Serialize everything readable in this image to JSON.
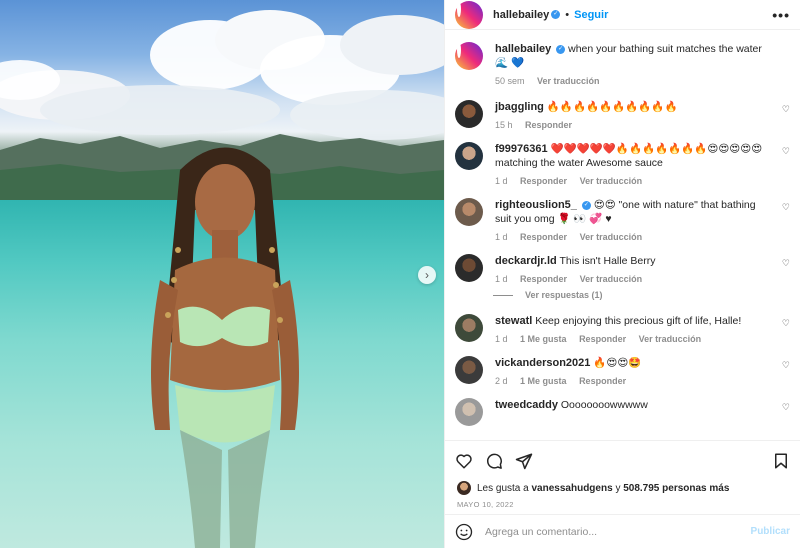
{
  "post": {
    "account": "hallebailey",
    "follow_label": "Seguir",
    "more_label": "•••",
    "separator": "•"
  },
  "caption": {
    "user": "hallebailey",
    "text": "when your bathing suit matches the water 🌊 💙",
    "age": "50 sem",
    "translate": "Ver traducción"
  },
  "comments": [
    {
      "user": "jbaggling",
      "text": "🔥🔥🔥🔥🔥🔥🔥🔥🔥🔥",
      "time": "15 h",
      "likes": "",
      "reply": "Responder",
      "translate": ""
    },
    {
      "user": "f99976361",
      "text": "❤️❤️❤️❤️❤️🔥🔥🔥🔥🔥🔥🔥😍😍😍😍😍 matching the water Awesome sauce",
      "time": "1 d",
      "likes": "",
      "reply": "Responder",
      "translate": "Ver traducción"
    },
    {
      "user": "righteouslion5_",
      "text": "😍😍 \"one with nature\" that bathing suit you omg 🌹 👀 💞 ♥",
      "time": "1 d",
      "likes": "",
      "reply": "Responder",
      "translate": "Ver traducción"
    },
    {
      "user": "deckardjr.ld",
      "text": "This isn't Halle Berry",
      "time": "1 d",
      "likes": "",
      "reply": "Responder",
      "translate": "Ver traducción"
    },
    {
      "user": "stewatl",
      "text": "Keep enjoying this precious gift of life, Halle!",
      "time": "1 d",
      "likes": "1 Me gusta",
      "reply": "Responder",
      "translate": "Ver traducción"
    },
    {
      "user": "vickanderson2021",
      "text": "🔥😍😍🤩",
      "time": "2 d",
      "likes": "1 Me gusta",
      "reply": "Responder",
      "translate": ""
    },
    {
      "user": "tweedcaddy",
      "text": "Oooooooowwwww",
      "time": "",
      "likes": "",
      "reply": "",
      "translate": ""
    }
  ],
  "view_replies": "Ver respuestas (1)",
  "likes": {
    "prefix": "Les gusta a",
    "user": "vanessahudgens",
    "mid": "y",
    "count": "508.795 personas más"
  },
  "date": "MAYO 10, 2022",
  "add_comment": {
    "placeholder": "Agrega un comentario...",
    "post_label": "Publicar"
  },
  "icons": {
    "heart": "heart-icon",
    "comment": "comment-icon",
    "share": "share-icon",
    "save": "bookmark-icon",
    "emoji": "emoji-icon",
    "next": "chevron-right-icon"
  },
  "colors": {
    "accent": "#0095f6",
    "verified": "#3897f0",
    "muted": "#8e8e8e"
  }
}
